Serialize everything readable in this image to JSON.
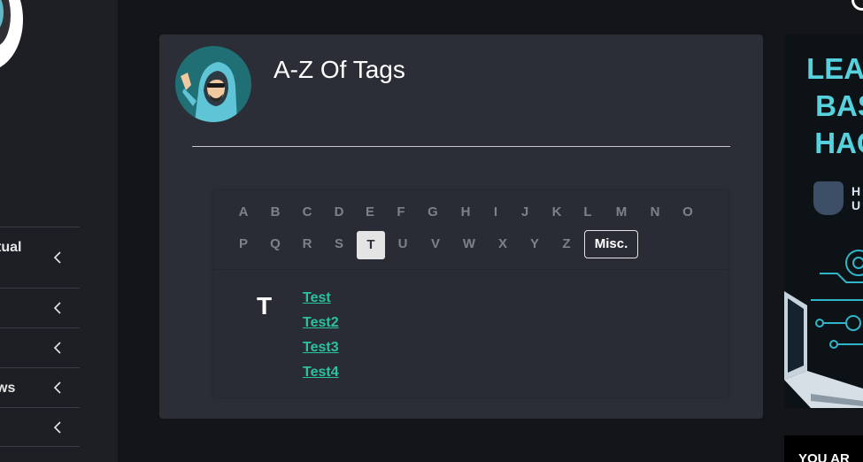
{
  "sidebar": {
    "items": [
      {
        "label": "tual"
      },
      {
        "label": ""
      },
      {
        "label": ""
      },
      {
        "label": "ws"
      },
      {
        "label": ""
      }
    ]
  },
  "card": {
    "title": "A-Z Of Tags"
  },
  "az": {
    "row1": [
      "A",
      "B",
      "C",
      "D",
      "E",
      "F",
      "G",
      "H",
      "I",
      "J",
      "K",
      "L",
      "M",
      "N",
      "O"
    ],
    "row2": [
      "P",
      "Q",
      "R",
      "S",
      "T",
      "U",
      "V",
      "W",
      "X",
      "Y",
      "Z"
    ],
    "active_letter": "T",
    "misc_label": "Misc.",
    "group_letter": "T",
    "tags": [
      "Test",
      "Test2",
      "Test3",
      "Test4"
    ]
  },
  "ad": {
    "title_lines": [
      "LEAR",
      "BAS",
      "HAC"
    ],
    "brand_lines": [
      "H",
      "U"
    ],
    "bottom_text": "YOU AR"
  },
  "colors": {
    "background": "#141519",
    "card": "#2b2e37",
    "tag_link": "#2bc2a0",
    "ad_accent": "#56d2df"
  }
}
